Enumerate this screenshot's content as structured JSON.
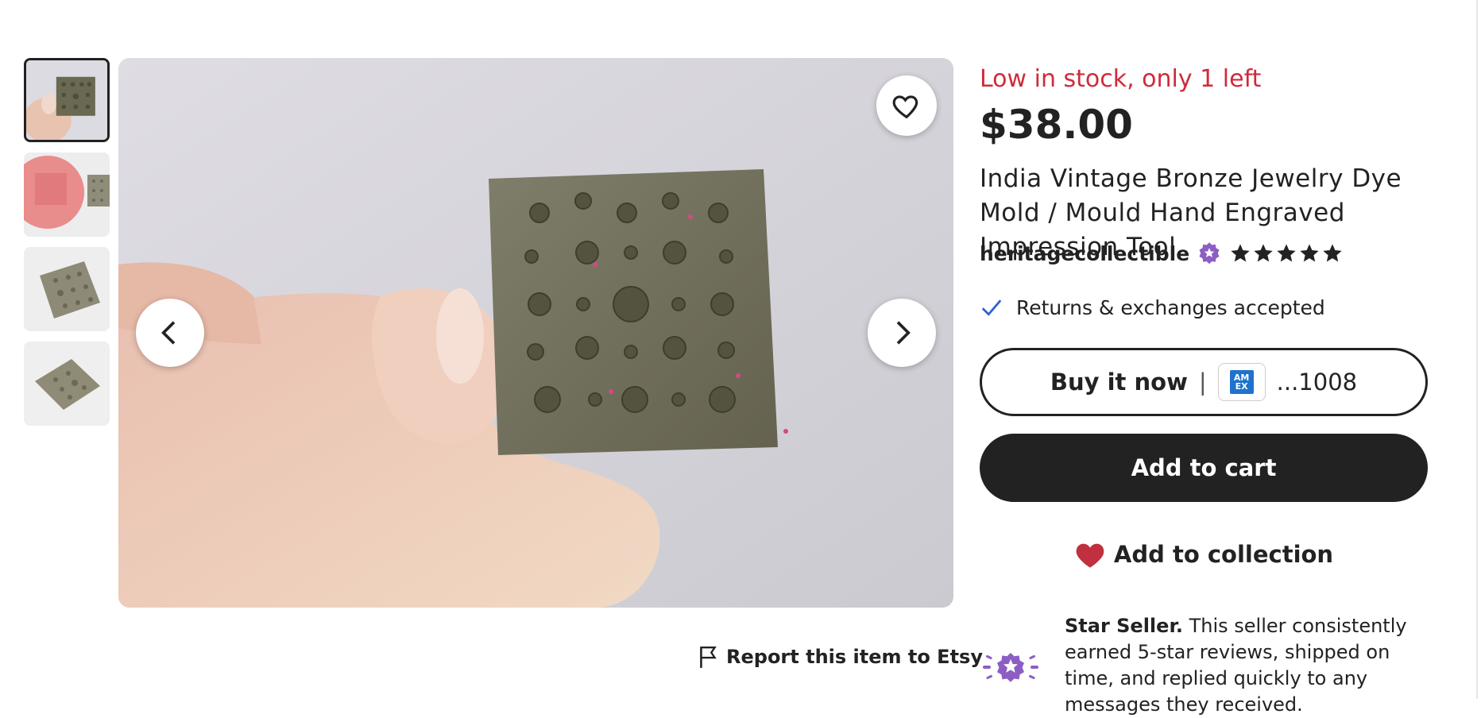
{
  "gallery": {
    "thumbnails": [
      {
        "name": "thumb-1",
        "active": true
      },
      {
        "name": "thumb-2",
        "active": false
      },
      {
        "name": "thumb-3",
        "active": false
      },
      {
        "name": "thumb-4",
        "active": false
      }
    ],
    "favorite_icon": "heart-outline-icon",
    "prev_icon": "chevron-left-icon",
    "next_icon": "chevron-right-icon"
  },
  "report": {
    "label": "Report this item to Etsy",
    "icon": "flag-icon"
  },
  "listing": {
    "stock": "Low in stock, only 1 left",
    "price": "$38.00",
    "title": "India Vintage Bronze Jewelry Dye Mold / Mould Hand Engraved Impression Tool",
    "seller": "heritagecollectible",
    "rating_stars": 5,
    "returns": "Returns & exchanges accepted"
  },
  "actions": {
    "buy_now_label": "Buy it now",
    "buy_now_sep": "|",
    "card_brand": "AM EX",
    "card_suffix": "...1008",
    "add_to_cart": "Add to cart",
    "add_to_collection": "Add to collection"
  },
  "star_seller": {
    "heading": "Star Seller.",
    "text": " This seller consistently earned 5-star reviews, shipped on time, and replied quickly to any messages they received."
  },
  "colors": {
    "stock_red": "#cf2b3b",
    "dark": "#222222",
    "badge_purple": "#8c5ec4",
    "heart_red": "#c0303e",
    "check_blue": "#2c5fd6"
  }
}
